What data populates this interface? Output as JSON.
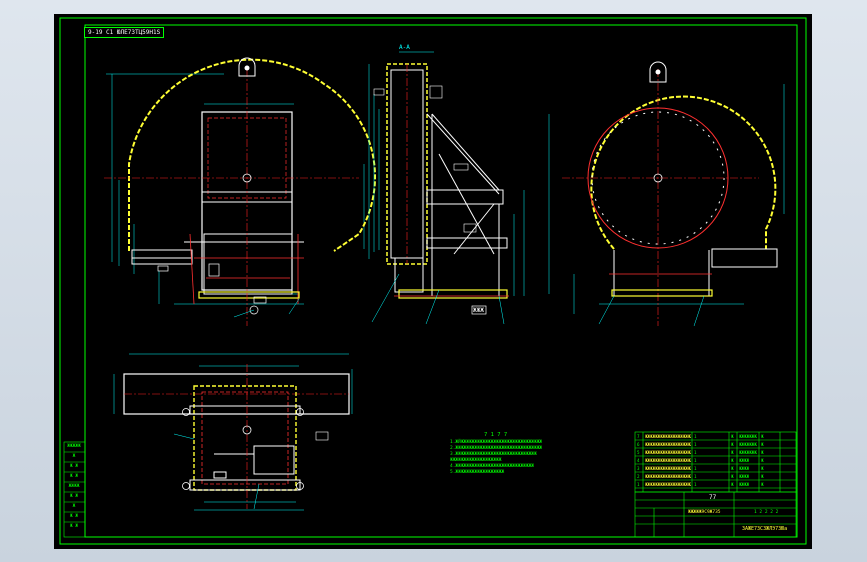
{
  "drawing": {
    "title_tag": "9-19 C1 ЮЛЕ7ЗТЦ59Н1S",
    "tech_requirements_title": "7 1 7 7",
    "notes": [
      "1.ЖЙЖЖЖЖЖЖЖЖЖЖЖЖЖЖЖЖЖЖЖЖЖЖЖЖЖЖЖЖЖЖ",
      "2.ЖЖЖЖЖЖЖЖЖЖЖЖЖЖЖЖЖЖЖЖЖЖЖЖЖЖЖЖЖЖЖЖ",
      "3.ЖЖЖЖЖЖЖЖЖЖЖЖЖЖЖЖЖЖЖЖЖЖЖЖЖЖЖЖЖЖ",
      "  ЖЖЖЖЖЖЖЖЖЖЖЖЖЖЖЖЖЖЖ",
      "4.ЖЖЖЖЖЖЖЖЖЖЖЖЖЖЖЖЖЖЖЖЖЖЖЖЖЖЖЖЖ",
      "5.ЖЖЖЖЖЖЖЖЖЖЖЖЖЖЖЖЖЖ"
    ],
    "parts_rows": [
      [
        "7",
        "ЖЖЖЖЖЖЖЖЖЖЖЖЖЖЖЖЖЖЖЖЖ",
        "1",
        "Ж",
        "ЖЖЖЖЖЖЖЖ",
        "Ж"
      ],
      [
        "6",
        "ЖЖЖЖЖЖЖЖЖЖЖЖЖЖЖЖЖЖЖЖЖ",
        "1",
        "Ж",
        "ЖЖЖЖЖЖЖЖ",
        "Ж"
      ],
      [
        "5",
        "ЖЖЖЖЖЖЖЖЖЖЖЖЖЖЖЖЖЖЖЖЖ",
        "1",
        "Ж",
        "ЖЖЖЖЖЖЖЖ",
        "Ж"
      ],
      [
        "4",
        "ЖЖЖЖЖЖЖЖЖЖЖЖЖЖЖЖЖЖЖЖЖ",
        "1",
        "Ж",
        "ЖЖЖЖ",
        "Ж"
      ],
      [
        "3",
        "ЖЖЖЖЖЖЖЖЖЖЖЖЖЖЖЖЖЖЖЖЖ",
        "1",
        "Ж",
        "ЖЖЖЖ",
        "Ж"
      ],
      [
        "2",
        "ЖЖЖЖЖЖЖЖЖЖЖЖЖЖЖЖЖЖЖЖЖ",
        "1",
        "Ж",
        "ЖЖЖЖ",
        "Ж"
      ],
      [
        "1",
        "ЖЖЖЖЖЖЖЖЖЖЖЖЖЖЖЖЖЖЖЖЖ",
        "1",
        "Ж",
        "ЖЖЖЖ",
        "Ж"
      ]
    ],
    "title_block": {
      "header": "77",
      "drawing_name": "ЖЖЖЖЖ9С9Ж7З5",
      "code": "1 2 2 2 2",
      "designation": "ЗАЖЕ7ЗСЗЖЛЭ7ЗЮа"
    },
    "revision_cells": [
      "ЖЖЖЖЖ",
      "Ж",
      "Ж Ж",
      "Ж Ж",
      "ЖЖЖЖ",
      "Ж Ж",
      "Ж",
      "Ж Ж",
      "Ж Ж"
    ],
    "section_label": "A-A",
    "view_label": "ЖЖЖ"
  },
  "colors": {
    "sheet_background": "#000000",
    "frame": "#00ff00",
    "outline": "#ffffff",
    "casing": "#ffff33",
    "centerline": "#ff2020",
    "dimension": "#00ffff"
  }
}
